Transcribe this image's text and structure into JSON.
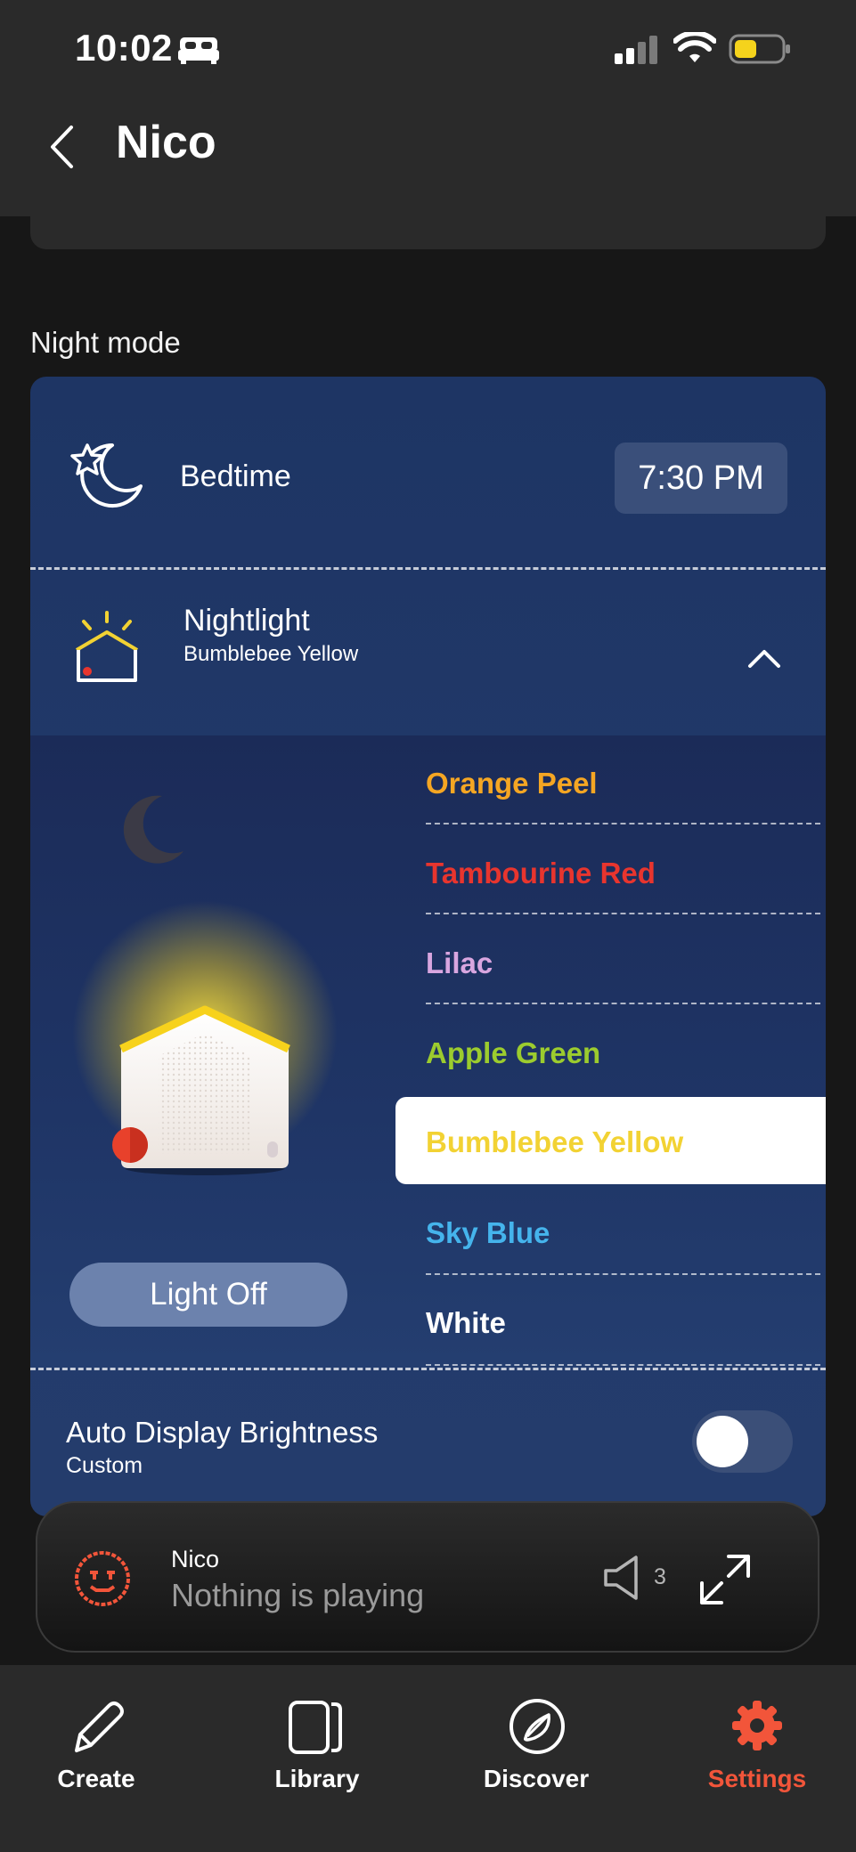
{
  "status_bar": {
    "time": "10:02"
  },
  "header": {
    "title": "Nico"
  },
  "night_mode": {
    "section_title": "Night mode",
    "bedtime": {
      "label": "Bedtime",
      "time": "7:30 PM"
    },
    "nightlight": {
      "label": "Nightlight",
      "selected_color": "Bumblebee Yellow",
      "light_button": "Light Off",
      "colors": [
        {
          "name": "Orange Peel",
          "color": "#f5a623"
        },
        {
          "name": "Tambourine Red",
          "color": "#e8352e"
        },
        {
          "name": "Lilac",
          "color": "#d9a6e0"
        },
        {
          "name": "Apple Green",
          "color": "#9ccc2e"
        },
        {
          "name": "Bumblebee Yellow",
          "color": "#f2d233"
        },
        {
          "name": "Sky Blue",
          "color": "#45b4ec"
        },
        {
          "name": "White",
          "color": "#ffffff"
        }
      ]
    },
    "auto_brightness": {
      "label": "Auto Display Brightness",
      "value": "Custom",
      "enabled": false
    }
  },
  "player": {
    "device": "Nico",
    "status": "Nothing is playing",
    "volume": "3"
  },
  "tabs": [
    {
      "label": "Create",
      "icon": "pencil-icon",
      "active": false
    },
    {
      "label": "Library",
      "icon": "library-icon",
      "active": false
    },
    {
      "label": "Discover",
      "icon": "compass-icon",
      "active": false
    },
    {
      "label": "Settings",
      "icon": "gear-icon",
      "active": true
    }
  ],
  "colors": {
    "accent": "#f2553a",
    "card": "#1f3566",
    "background": "#171717"
  }
}
